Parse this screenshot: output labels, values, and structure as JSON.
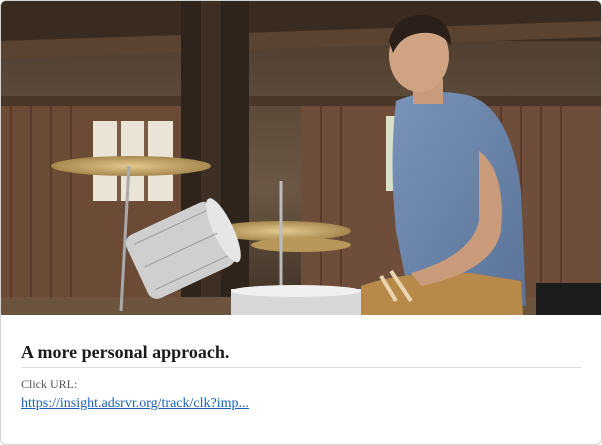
{
  "ad": {
    "image_alt": "Man sitting at a drum kit in a rustic barn",
    "headline": "A more personal approach.",
    "click_url_label": "Click URL:",
    "click_url_text": "https://insight.adsrvr.org/track/clk?imp..."
  },
  "colors": {
    "link": "#1a5fb4",
    "headline": "#1a1a1a",
    "border": "#d4d4d4"
  }
}
